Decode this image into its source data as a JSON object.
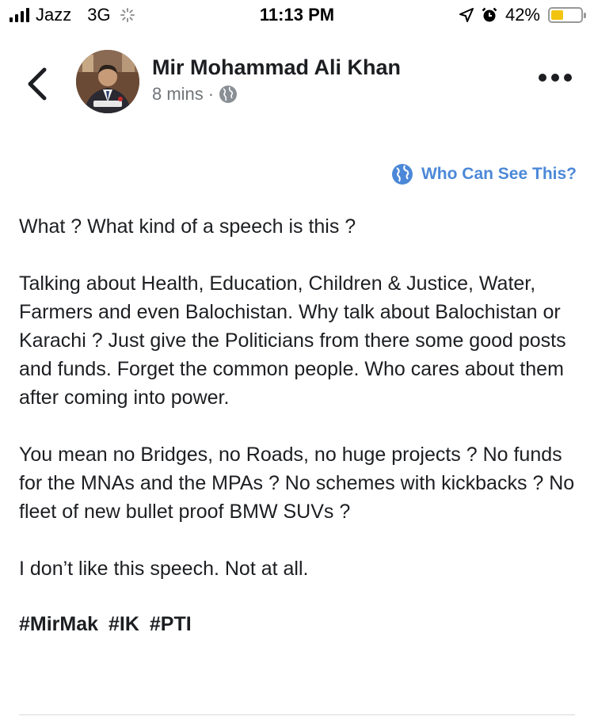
{
  "status_bar": {
    "carrier": "Jazz",
    "network": "3G",
    "time": "11:13 PM",
    "battery": "42%",
    "battery_level": 0.42,
    "battery_color": "#f2c40f"
  },
  "post": {
    "author": "Mir Mohammad Ali Khan",
    "timestamp": "8 mins",
    "separator": "·",
    "privacy_icon": "globe-icon",
    "who_can_see": "Who Can See This?",
    "paragraphs": [
      "What ? What kind of a speech is this ?",
      "Talking about Health, Education, Children & Justice, Water, Farmers and even Balochistan. Why talk about Balochistan or Karachi ? Just give the Politicians from there some good posts and funds. Forget the common people. Who cares about them after coming into power.",
      "You mean no Bridges, no Roads, no huge projects ? No funds for the MNAs and the MPAs ? No schemes with kickbacks ? No fleet of new bullet proof BMW SUVs ?",
      "I don’t like this speech. Not at all."
    ],
    "hashtags": [
      "#MirMak",
      "#IK",
      "#PTI"
    ]
  },
  "colors": {
    "link": "#4c88d8",
    "text": "#1c1e21",
    "meta": "#707579"
  }
}
